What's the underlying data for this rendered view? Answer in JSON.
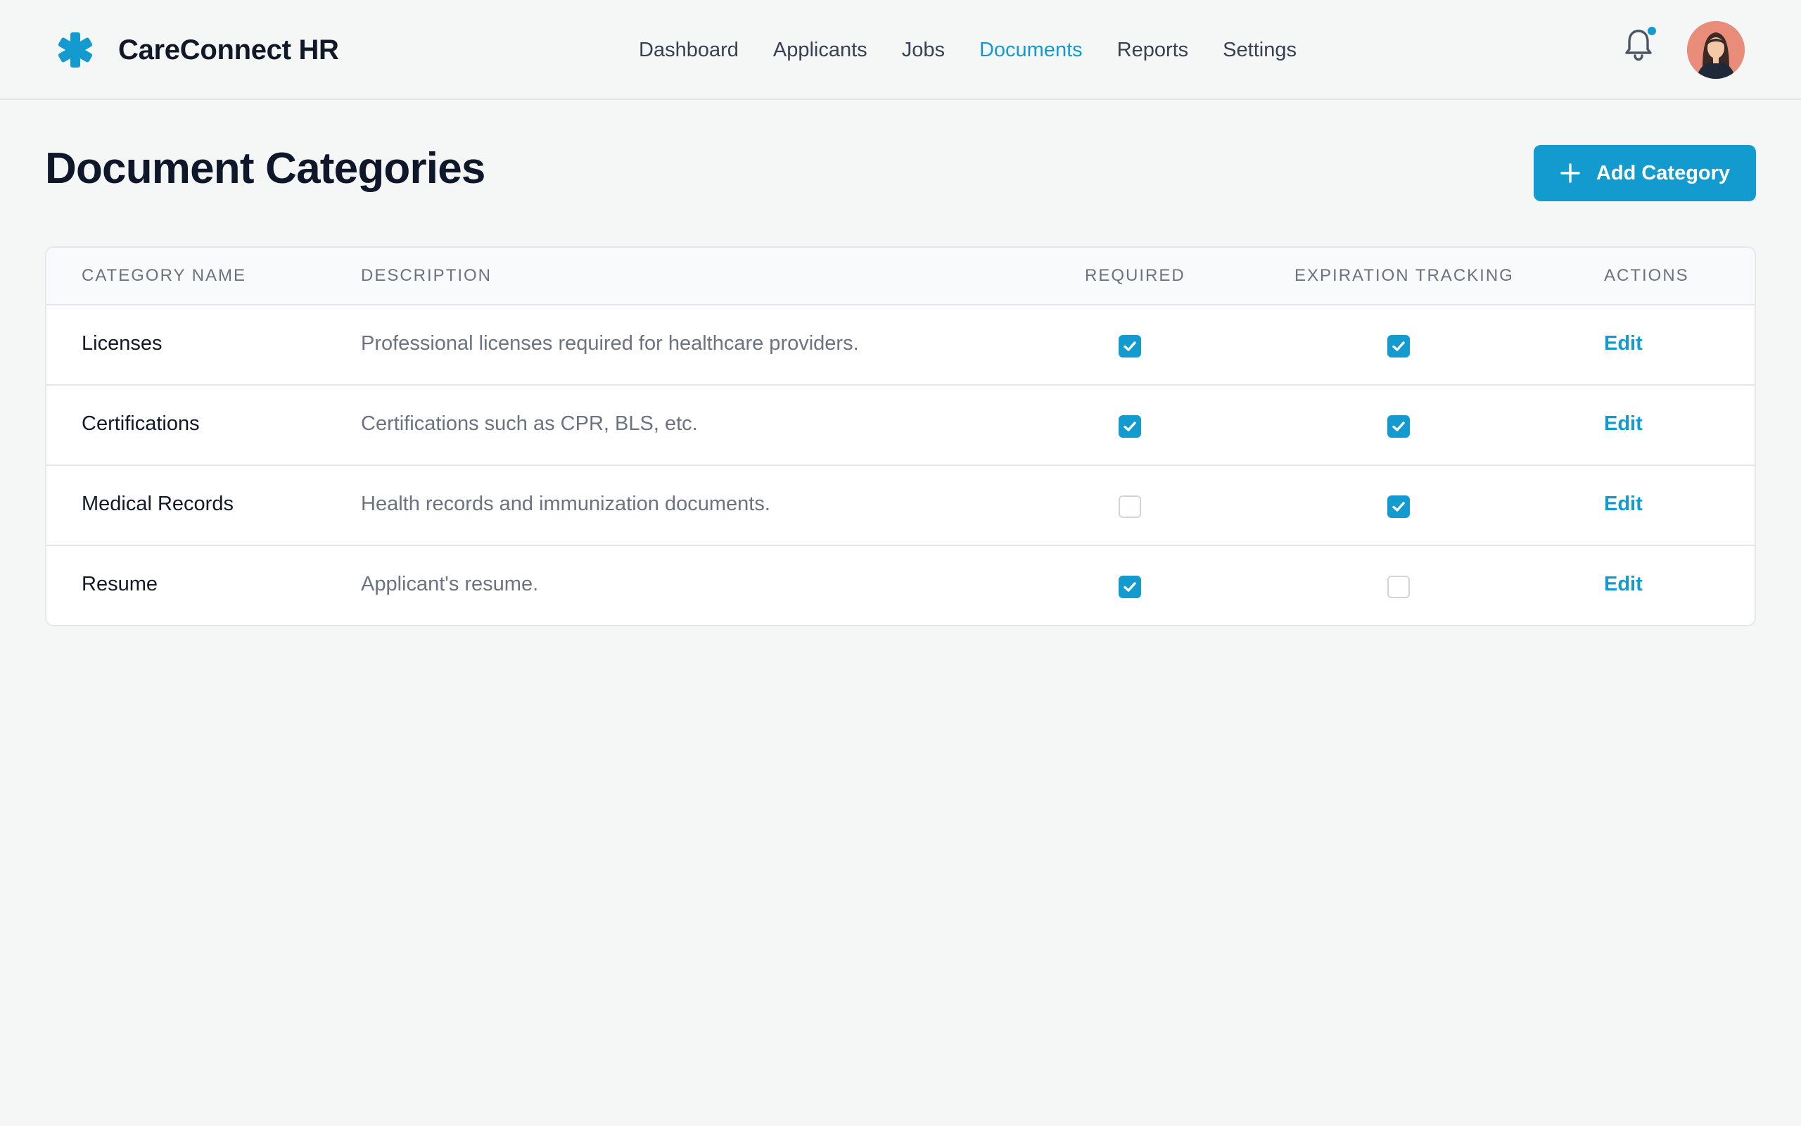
{
  "app": {
    "name": "CareConnect HR",
    "logo_icon": "medical-asterisk-icon",
    "accent_color": "#139bd0"
  },
  "nav": {
    "items": [
      {
        "label": "Dashboard",
        "active": false
      },
      {
        "label": "Applicants",
        "active": false
      },
      {
        "label": "Jobs",
        "active": false
      },
      {
        "label": "Documents",
        "active": true
      },
      {
        "label": "Reports",
        "active": false
      },
      {
        "label": "Settings",
        "active": false
      }
    ]
  },
  "header": {
    "notification_icon": "bell-icon",
    "has_unread": true,
    "avatar_icon": "user-avatar"
  },
  "page": {
    "title": "Document Categories",
    "add_button_label": "Add Category"
  },
  "table": {
    "columns": [
      "CATEGORY NAME",
      "DESCRIPTION",
      "REQUIRED",
      "EXPIRATION TRACKING",
      "ACTIONS"
    ],
    "rows": [
      {
        "name": "Licenses",
        "description": "Professional licenses required for healthcare providers.",
        "required": true,
        "expiration_tracking": true,
        "action": "Edit"
      },
      {
        "name": "Certifications",
        "description": "Certifications such as CPR, BLS, etc.",
        "required": true,
        "expiration_tracking": true,
        "action": "Edit"
      },
      {
        "name": "Medical Records",
        "description": "Health records and immunization documents.",
        "required": false,
        "expiration_tracking": true,
        "action": "Edit"
      },
      {
        "name": "Resume",
        "description": "Applicant's resume.",
        "required": true,
        "expiration_tracking": false,
        "action": "Edit"
      }
    ]
  }
}
